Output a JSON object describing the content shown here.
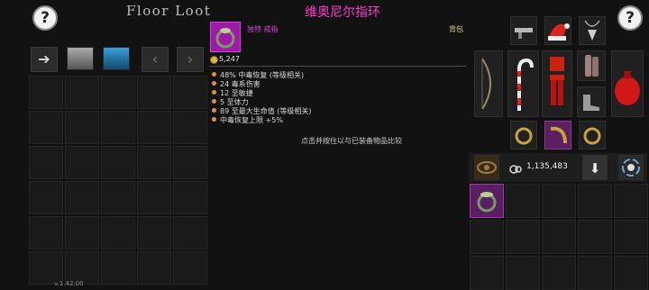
{
  "version": "v.1.42.00",
  "floor_loot": {
    "title": "Floor Loot",
    "help_label": "?",
    "nav": {
      "forward": "➔",
      "prev": "‹",
      "next": "›"
    }
  },
  "tooltip": {
    "item_name": "维奥尼尔指环",
    "rarity_type": "独特 戒指",
    "location": "背包",
    "price": "5,247",
    "stats": [
      "48% 中毒恢复 (等级相关)",
      "24 毒系伤害",
      "12 至敏捷",
      "5 至体力",
      "89 至最大生命值 (等级相关)",
      "中毒恢复上限 +5%"
    ],
    "compare_hint": "点击并按住以与已装备物品比较"
  },
  "equipment": {
    "help_label": "?",
    "gold": "1,135,483",
    "down_arrow": "⬇"
  },
  "colors": {
    "unique_name": "#ff3ad1",
    "unique_bg": "#9c1ca8",
    "bag_label": "#e5d77a",
    "stat_bullet": "#e0913a"
  }
}
